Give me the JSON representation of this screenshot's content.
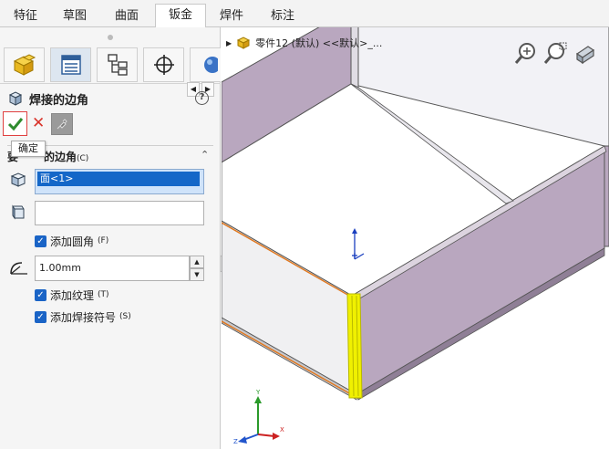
{
  "tabs": [
    {
      "label": "特征",
      "active": false
    },
    {
      "label": "草图",
      "active": false
    },
    {
      "label": "曲面",
      "active": false
    },
    {
      "label": "钣金",
      "active": true
    },
    {
      "label": "焊件",
      "active": false
    },
    {
      "label": "标注",
      "active": false
    }
  ],
  "property_manager": {
    "title": "焊接的边角",
    "help_glyph": "?",
    "ok_tooltip": "确定",
    "group": {
      "prefix": "要",
      "label": "的边角",
      "shortcut": "(C)"
    },
    "selection_item": "面<1>",
    "add_fillet": {
      "label": "添加圆角",
      "shortcut": "(F)",
      "checked": true
    },
    "radius_value": "1.00mm",
    "add_texture": {
      "label": "添加纹理",
      "shortcut": "(T)",
      "checked": true
    },
    "add_weld_symbol": {
      "label": "添加焊接符号",
      "shortcut": "(S)",
      "checked": true
    }
  },
  "viewport": {
    "tree_item": "零件12 (默认) <<默认>_..."
  },
  "triad": {
    "x": "X",
    "y": "Y",
    "z": "Z"
  },
  "colors": {
    "accent_blue": "#1467c8",
    "wall_purple": "#b9a7bf",
    "edge_highlight": "#f0f000",
    "edge_orange": "#e07820",
    "ok_green": "#2e8b2e",
    "cancel_red": "#d9342b"
  },
  "icons": [
    "part-icon",
    "property-manager-icon",
    "configuration-icon",
    "display-target-icon",
    "appearance-icon",
    "face-icon",
    "radius-icon",
    "zoom-fit-icon",
    "zoom-area-icon",
    "view-orient-icon",
    "weld-corner-icon",
    "pin-icon"
  ]
}
